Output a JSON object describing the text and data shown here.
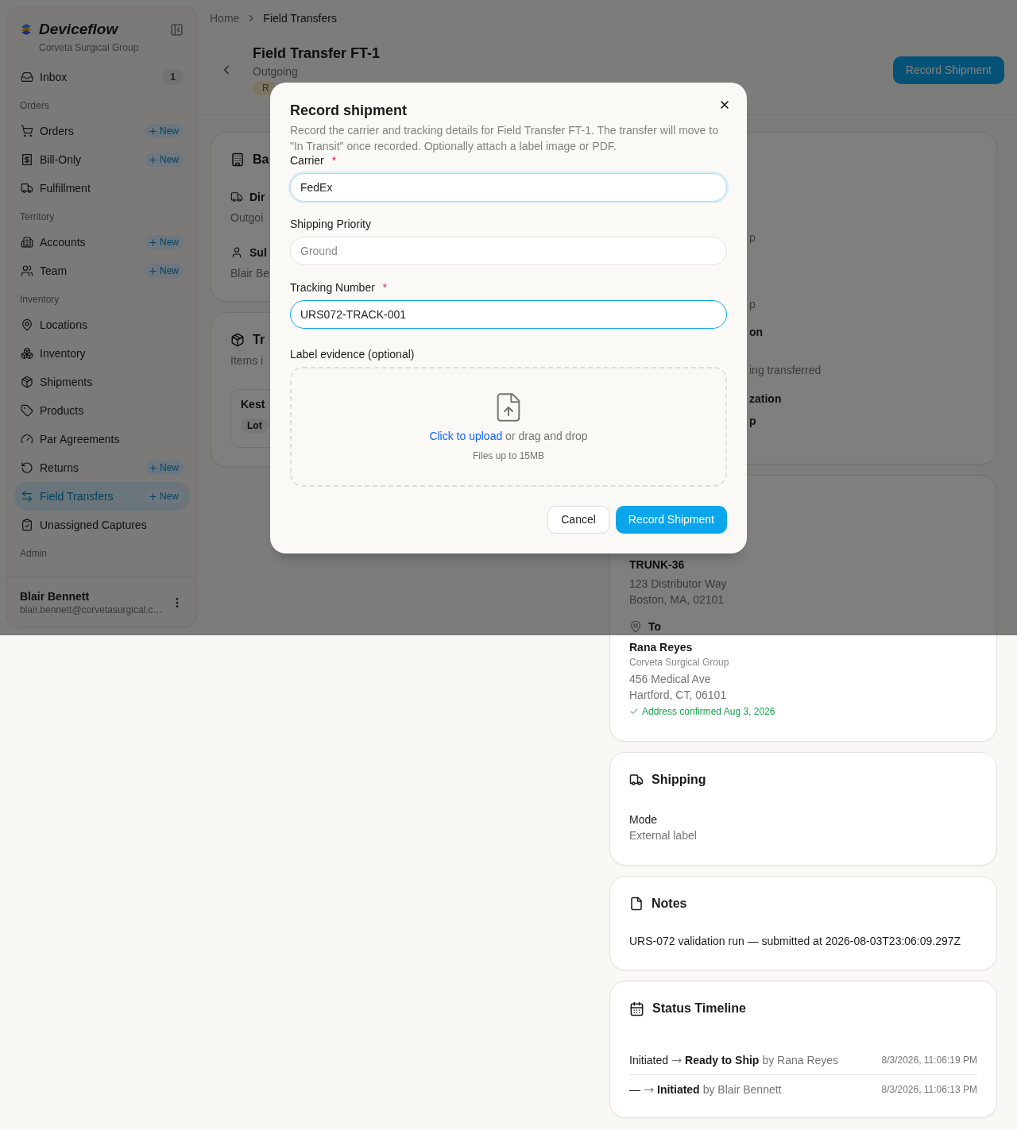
{
  "sidebar": {
    "brand": "Deviceflow",
    "org": "Corveta Surgical Group",
    "items": [
      {
        "kind": "link",
        "label": "Inbox",
        "badge": "1",
        "selected": false
      },
      {
        "kind": "heading",
        "label": "Orders"
      },
      {
        "kind": "link",
        "label": "Orders",
        "new": "New",
        "selected": false
      },
      {
        "kind": "link",
        "label": "Bill-Only",
        "new": "New",
        "selected": false
      },
      {
        "kind": "link",
        "label": "Fulfillment",
        "selected": false
      },
      {
        "kind": "heading",
        "label": "Territory"
      },
      {
        "kind": "link",
        "label": "Accounts",
        "new": "New",
        "selected": false
      },
      {
        "kind": "link",
        "label": "Team",
        "new": "New",
        "selected": false
      },
      {
        "kind": "heading",
        "label": "Inventory"
      },
      {
        "kind": "link",
        "label": "Locations",
        "selected": false
      },
      {
        "kind": "link",
        "label": "Inventory",
        "selected": false
      },
      {
        "kind": "link",
        "label": "Shipments",
        "selected": false
      },
      {
        "kind": "link",
        "label": "Products",
        "selected": false
      },
      {
        "kind": "link",
        "label": "Par Agreements",
        "selected": false
      },
      {
        "kind": "link",
        "label": "Returns",
        "new": "New",
        "selected": false
      },
      {
        "kind": "link",
        "label": "Field Transfers",
        "new": "New",
        "selected": true
      },
      {
        "kind": "link",
        "label": "Unassigned Captures",
        "selected": false
      },
      {
        "kind": "heading",
        "label": "Admin"
      }
    ],
    "user": {
      "name": "Blair Bennett",
      "email": "blair.bennett@corvetasurgical.c…"
    }
  },
  "breadcrumb": [
    {
      "label": "Home",
      "current": false
    },
    {
      "label": "Field Transfers",
      "current": true
    }
  ],
  "header": {
    "title": "Field Transfer FT-1",
    "subtitle": "Outgoing",
    "badge": "R",
    "action": "Record Shipment"
  },
  "details_card": {
    "title": "Ba",
    "rows": [
      {
        "label": "Dir",
        "value": "Outgoi"
      },
      {
        "label": "Sul",
        "value": "Blair Be"
      }
    ]
  },
  "items_card": {
    "title": "Tr",
    "subtitle": "Items i",
    "item": {
      "name": "Kest",
      "badge": "Lot"
    }
  },
  "summary_card": {
    "fragments": [
      {
        "kind": "muted",
        "text": "p"
      },
      {
        "kind": "muted",
        "text": "p"
      },
      {
        "kind": "strong",
        "text": "on"
      },
      {
        "kind": "muted",
        "text": "ing transferred"
      },
      {
        "kind": "strong",
        "text": "zation"
      },
      {
        "kind": "strong",
        "text": "p"
      }
    ]
  },
  "route_card": {
    "from": {
      "name": "TRUNK-36",
      "lines": [
        "123 Distributor Way",
        "Boston, MA, 02101"
      ]
    },
    "to": {
      "label": "To",
      "name": "Rana Reyes",
      "org": "Corveta Surgical Group",
      "lines": [
        "456 Medical Ave",
        "Hartford, CT, 06101"
      ],
      "confirmation": "Address confirmed Aug 3, 2026"
    }
  },
  "shipping_card": {
    "title": "Shipping",
    "label": "Mode",
    "value": "External label"
  },
  "notes_card": {
    "title": "Notes",
    "text": "URS-072 validation run — submitted at 2026-08-03T23:06:09.297Z"
  },
  "timeline": {
    "title": "Status Timeline",
    "entries": [
      {
        "from": "Initiated",
        "to": "Ready to Ship",
        "by": "by Rana Reyes",
        "time": "8/3/2026, 11:06:19 PM"
      },
      {
        "from": "—",
        "to": "Initiated",
        "by": "by Blair Bennett",
        "time": "8/3/2026, 11:06:13 PM"
      }
    ]
  },
  "modal": {
    "title": "Record shipment",
    "description": "Record the carrier and tracking details for Field Transfer FT-1. The transfer will move to \"In Transit\" once recorded. Optionally attach a label image or PDF.",
    "fields": [
      {
        "label": "Carrier",
        "required_mark": "*",
        "value": "FedEx",
        "focused": true,
        "highlighted": false
      },
      {
        "label": "Shipping Priority",
        "placeholder": "Ground",
        "focused": false,
        "highlighted": false
      },
      {
        "label": "Tracking Number",
        "required_mark": "*",
        "value": "URS072-TRACK-001",
        "focused": false,
        "highlighted": true
      }
    ],
    "upload": {
      "label": "Label evidence (optional)",
      "link": "Click to upload",
      "text": "or drag and drop",
      "hint": "Files up to 15MB"
    },
    "buttons": [
      {
        "label": "Cancel",
        "kind": "secondary"
      },
      {
        "label": "Record Shipment",
        "kind": "primary"
      }
    ]
  }
}
